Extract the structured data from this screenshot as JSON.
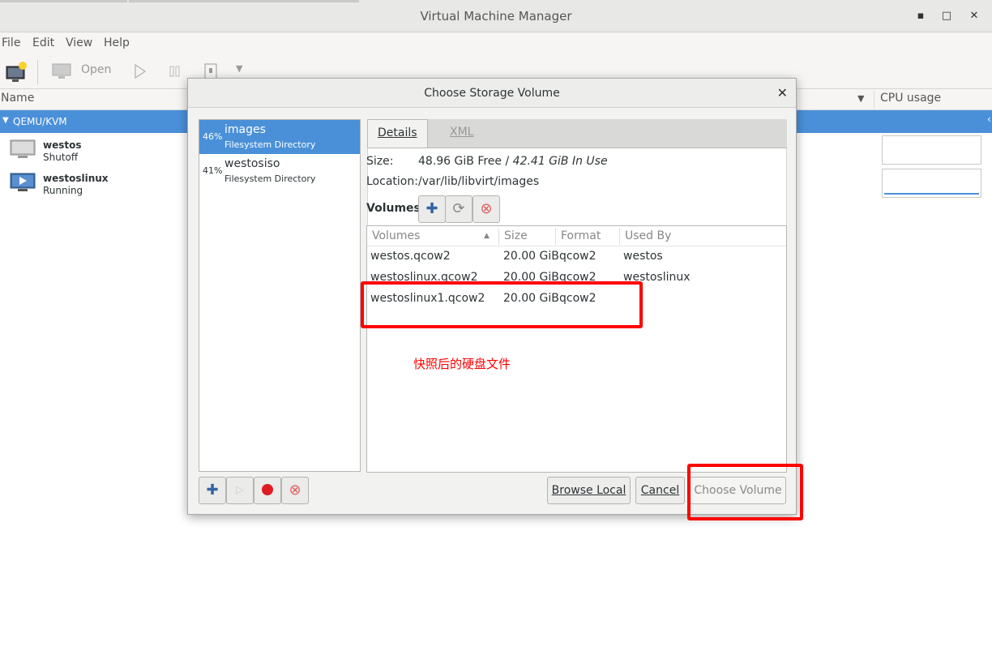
{
  "window": {
    "title": "Virtual Machine Manager",
    "menu": [
      "File",
      "Edit",
      "View",
      "Help"
    ],
    "toolbar": {
      "open_label": "Open"
    },
    "list_header": {
      "name": "Name",
      "cpu": "CPU usage"
    },
    "connection": "QEMU/KVM",
    "vms": [
      {
        "name": "westos",
        "state": "Shutoff"
      },
      {
        "name": "westoslinux",
        "state": "Running"
      }
    ]
  },
  "dialog": {
    "title": "Choose Storage Volume",
    "pools": [
      {
        "pct": "46%",
        "name": "images",
        "type": "Filesystem Directory",
        "selected": true
      },
      {
        "pct": "41%",
        "name": "westosiso",
        "type": "Filesystem Directory",
        "selected": false
      }
    ],
    "tabs": {
      "details": "Details",
      "xml": "XML"
    },
    "size_label": "Size:",
    "size_free": "48.96 GiB Free",
    "size_sep": " / ",
    "size_used": "42.41 GiB In Use",
    "location_label": "Location:",
    "location_value": "/var/lib/libvirt/images",
    "volumes_label": "Volumes",
    "table": {
      "headers": [
        "Volumes",
        "Size",
        "Format",
        "Used By"
      ],
      "rows": [
        [
          "westos.qcow2",
          "20.00 GiB",
          "qcow2",
          "westos"
        ],
        [
          "westoslinux.qcow2",
          "20.00 GiB",
          "qcow2",
          "westoslinux"
        ],
        [
          "westoslinux1.qcow2",
          "20.00 GiB",
          "qcow2",
          ""
        ]
      ]
    },
    "annotation": "快照后的硬盘文件",
    "buttons": {
      "browse_local": "Browse Local",
      "cancel": "Cancel",
      "choose_volume": "Choose Volume"
    }
  },
  "colors": {
    "selection": "#4a90d9",
    "annotation": "#ff0000"
  }
}
